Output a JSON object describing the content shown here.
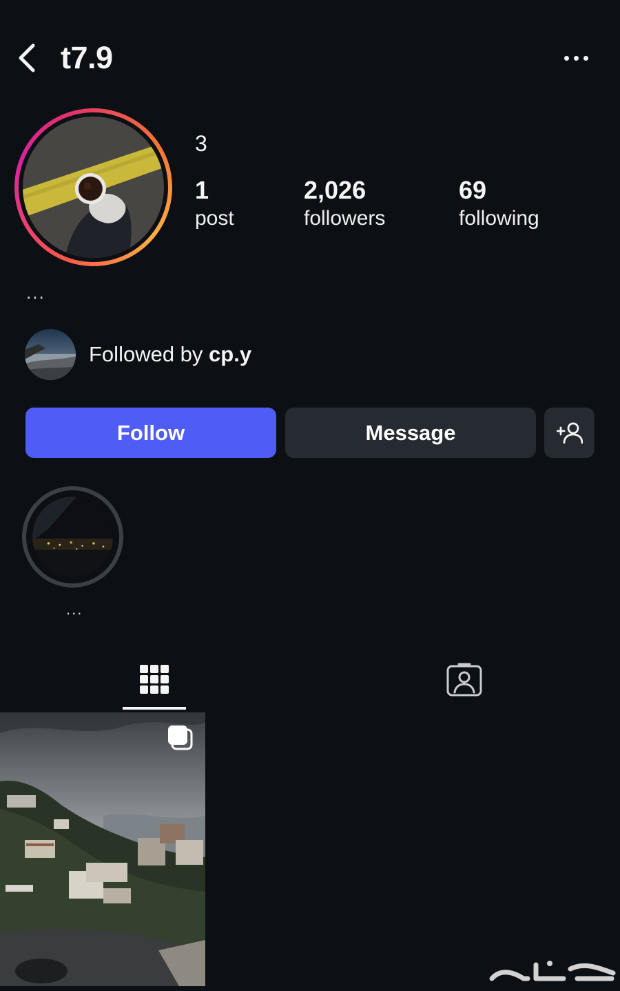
{
  "header": {
    "username": "t7.9",
    "back_icon": "chevron-left-icon",
    "more_icon": "more-horizontal-icon"
  },
  "profile": {
    "avatar_ring_colors": [
      "#fd5949",
      "#d6249f",
      "#fcaf45"
    ],
    "top_value": "3",
    "stats": [
      {
        "value": "1",
        "label": "post"
      },
      {
        "value": "2,026",
        "label": "followers"
      },
      {
        "value": "69",
        "label": "following"
      }
    ],
    "bio": "..."
  },
  "followed_by": {
    "prefix": "Followed by ",
    "username": "cp.y"
  },
  "actions": {
    "follow_label": "Follow",
    "message_label": "Message",
    "add_user_icon": "add-user-icon",
    "follow_color": "#4f5df6",
    "secondary_color": "#262a31"
  },
  "highlights": [
    {
      "title": "..."
    }
  ],
  "tabs": [
    {
      "name": "posts",
      "icon": "grid-icon",
      "active": true
    },
    {
      "name": "tagged",
      "icon": "tagged-user-icon",
      "active": false
    }
  ],
  "posts": [
    {
      "type": "carousel",
      "icon": "carousel-icon"
    }
  ],
  "watermark": "حراج"
}
